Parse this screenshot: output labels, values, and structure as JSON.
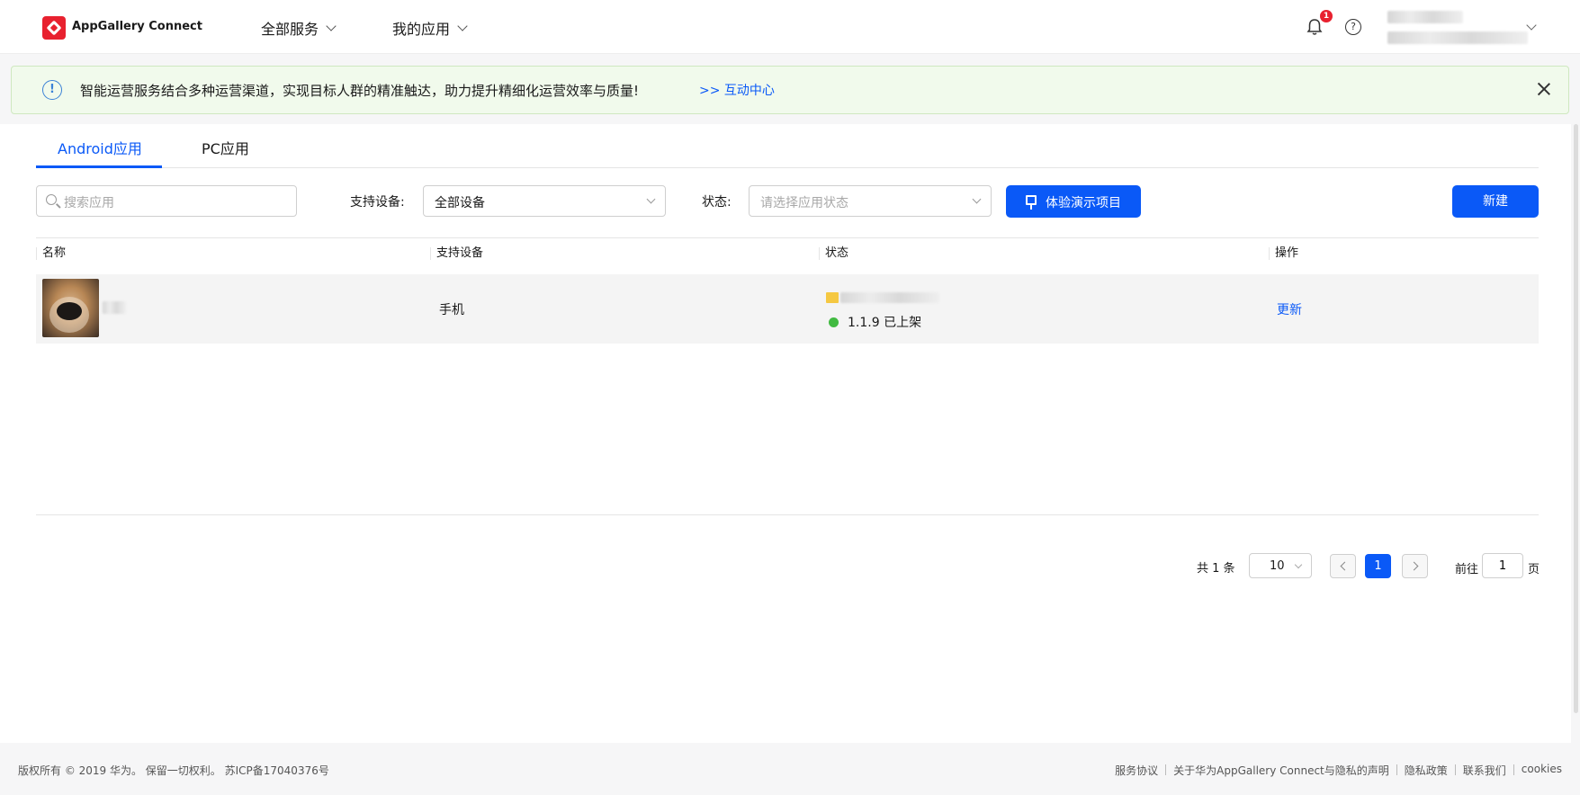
{
  "header": {
    "brand": "AppGallery Connect",
    "nav": [
      "全部服务",
      "我的应用"
    ],
    "notification_count": "1",
    "help_symbol": "?"
  },
  "notice": {
    "text": "智能运营服务结合多种运营渠道，实现目标人群的精准触达，助力提升精细化运营效率与质量!",
    "link": ">> 互动中心"
  },
  "tabs": [
    "Android应用",
    "PC应用"
  ],
  "filters": {
    "search_placeholder": "搜索应用",
    "device_label": "支持设备:",
    "device_value": "全部设备",
    "status_label": "状态:",
    "status_placeholder": "请选择应用状态",
    "demo_button": "体验演示项目",
    "new_button": "新建"
  },
  "table": {
    "headers": [
      "名称",
      "支持设备",
      "状态",
      "操作"
    ],
    "rows": [
      {
        "device": "手机",
        "status": "1.1.9 已上架",
        "action": "更新"
      }
    ]
  },
  "pagination": {
    "total": "共 1 条",
    "page_size": "10",
    "current_page": "1",
    "goto_label": "前往",
    "goto_value": "1",
    "page_suffix": "页"
  },
  "footer": {
    "copyright": "版权所有 © 2019 华为。 保留一切权利。 苏ICP备17040376号",
    "links": [
      "服务协议",
      "关于华为AppGallery Connect与隐私的声明",
      "隐私政策",
      "联系我们",
      "cookies"
    ]
  },
  "colors": {
    "primary": "#0a59f7",
    "brand_red": "#e8212f",
    "status_green": "#41ba41",
    "notice_bg": "#f1faec"
  }
}
